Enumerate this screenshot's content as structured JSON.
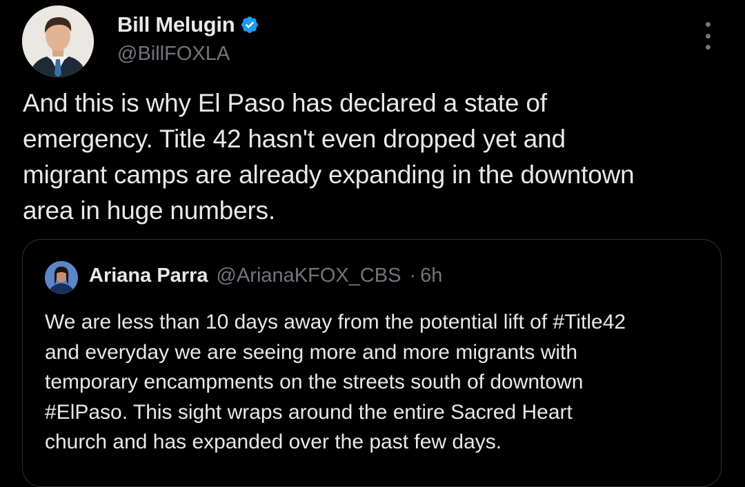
{
  "tweet": {
    "author": {
      "display_name": "Bill Melugin",
      "handle": "@BillFOXLA",
      "verified": true,
      "verified_color": "#1d9bf0"
    },
    "more_icon": "more-vertical-icon",
    "text_lines": [
      "And this is why El Paso has declared a state of",
      "emergency. Title 42 hasn't even dropped yet and",
      "migrant camps are already expanding in the downtown",
      "area in huge numbers."
    ]
  },
  "quote": {
    "author": {
      "display_name": "Ariana Parra",
      "handle": "@ArianaKFOX_CBS",
      "separator": "·",
      "time": "6h"
    },
    "text_lines": [
      "We are less than 10 days away from the potential lift of #Title42",
      "and everyday we are seeing more and more migrants with",
      "temporary encampments on the streets south of downtown",
      "#ElPaso. This sight wraps around the entire Sacred Heart",
      "church and has expanded over the past few days."
    ]
  },
  "colors": {
    "background": "#000000",
    "text_primary": "#e7e9ea",
    "text_secondary": "#71767b",
    "border": "#2f3336"
  }
}
